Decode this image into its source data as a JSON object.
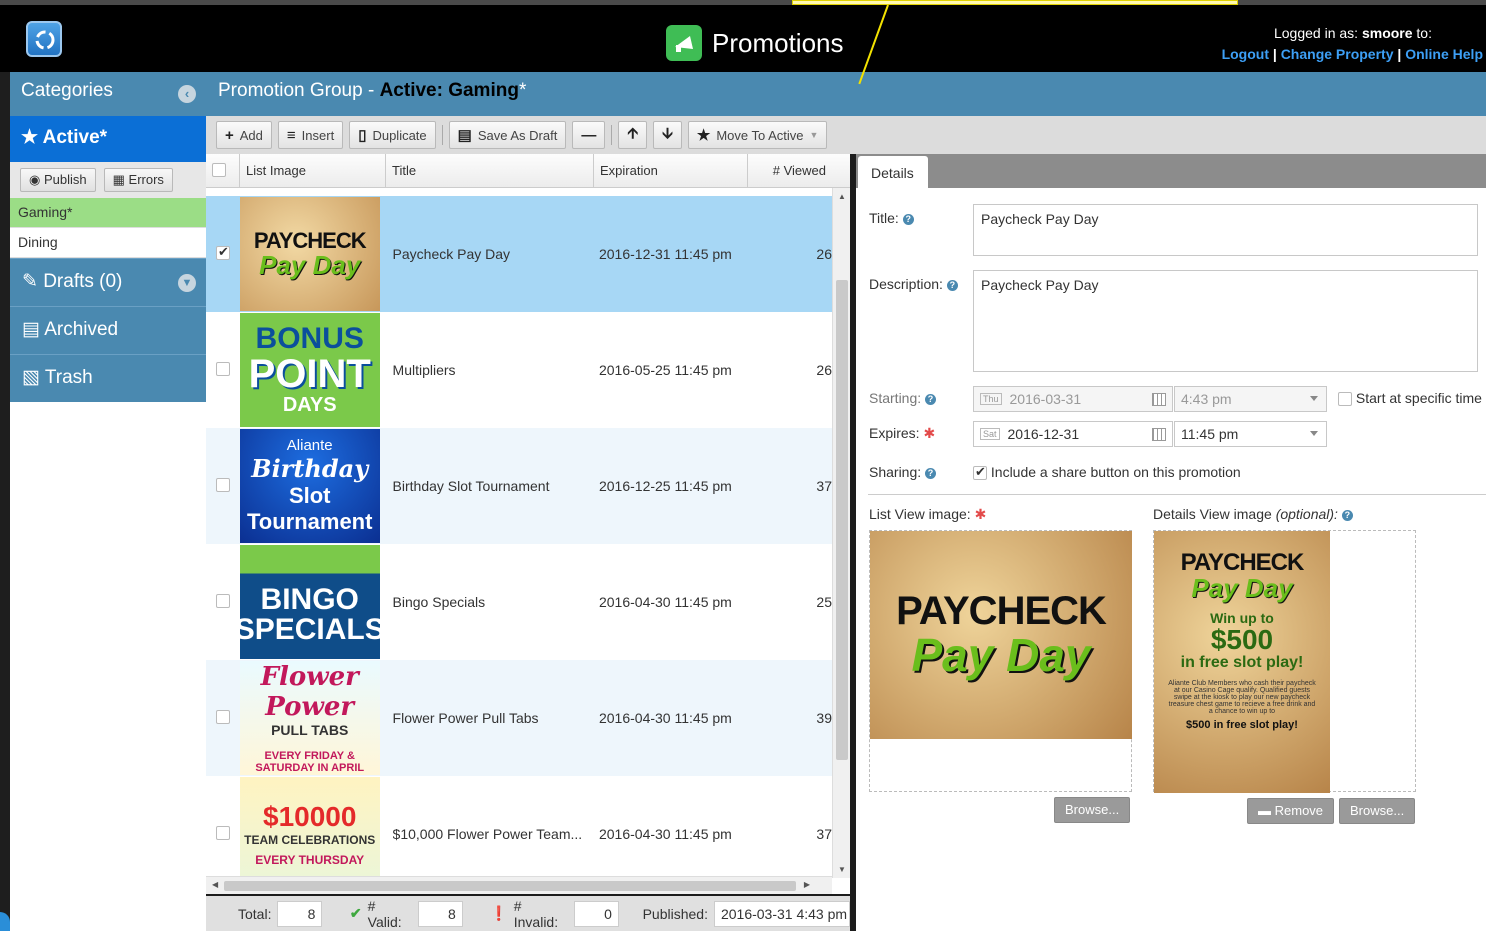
{
  "header": {
    "app_title": "Promotions",
    "logged_in_label": "Logged in as:",
    "username": "smoore",
    "logged_in_suffix": "to:",
    "links": [
      "Logout",
      "Change Property",
      "Online Help"
    ]
  },
  "sidebar": {
    "categories_label": "Categories",
    "active_label": "Active*",
    "publish_label": "Publish",
    "errors_label": "Errors",
    "category_items": [
      "Gaming*",
      "Dining"
    ],
    "drafts_label": "Drafts (0)",
    "archived_label": "Archived",
    "trash_label": "Trash"
  },
  "group_header": {
    "prefix": "Promotion Group - ",
    "name": "Active: Gaming",
    "suffix": "*"
  },
  "toolbar": {
    "add": "Add",
    "insert": "Insert",
    "duplicate": "Duplicate",
    "save_as_draft": "Save As Draft",
    "move_to_active": "Move To Active"
  },
  "list": {
    "columns": [
      "List Image",
      "Title",
      "Expiration",
      "# Viewed"
    ],
    "rows": [
      {
        "title": "Paycheck Pay Day",
        "expiration": "2016-12-31 11:45 pm",
        "viewed": "26",
        "thumb": {
          "t1": "PAYCHECK",
          "t2": "Pay Day"
        }
      },
      {
        "title": "Multipliers",
        "expiration": "2016-05-25 11:45 pm",
        "viewed": "26",
        "thumb": {
          "t1": "BONUS",
          "t2": "POINT",
          "t3": "DAYS"
        }
      },
      {
        "title": "Birthday Slot Tournament",
        "expiration": "2016-12-25 11:45 pm",
        "viewed": "37",
        "thumb": {
          "t1": "Aliante",
          "t2": "Birthday",
          "t3": "Slot Tournament"
        }
      },
      {
        "title": "Bingo Specials",
        "expiration": "2016-04-30 11:45 pm",
        "viewed": "25",
        "thumb": {
          "t1": "BINGO",
          "t2": "SPECIALS"
        }
      },
      {
        "title": "Flower Power Pull Tabs",
        "expiration": "2016-04-30 11:45 pm",
        "viewed": "39",
        "thumb": {
          "t1": "Flower Power",
          "t2": "PULL TABS",
          "t3": "EVERY FRIDAY & SATURDAY IN APRIL"
        }
      },
      {
        "title": "$10,000 Flower Power Team...",
        "expiration": "2016-04-30 11:45 pm",
        "viewed": "37",
        "thumb": {
          "t1": "$10000",
          "t2": "TEAM CELEBRATIONS",
          "t3": "EVERY THURSDAY"
        }
      }
    ]
  },
  "status": {
    "total_label": "Total:",
    "total": "8",
    "valid_label": "# Valid:",
    "valid": "8",
    "invalid_label": "# Invalid:",
    "invalid": "0",
    "published_label": "Published:",
    "published": "2016-03-31 4:43 pm"
  },
  "details": {
    "tab": "Details",
    "title_label": "Title:",
    "title_value": "Paycheck Pay Day",
    "description_label": "Description:",
    "description_value": "Paycheck Pay Day",
    "starting_label": "Starting:",
    "starting_day": "Thu",
    "starting_date": "2016-03-31",
    "starting_time": "4:43 pm",
    "start_specific_label": "Start at specific time",
    "expires_label": "Expires:",
    "expires_day": "Sat",
    "expires_date": "2016-12-31",
    "expires_time": "11:45 pm",
    "sharing_label": "Sharing:",
    "sharing_text": "Include a share button on this promotion",
    "list_view_label": "List View image:",
    "details_view_label": "Details View image",
    "optional_label": "(optional):",
    "browse": "Browse...",
    "remove": "Remove",
    "detail_image": {
      "t1": "PAYCHECK",
      "t2": "Pay Day",
      "t3": "Win up to",
      "t4": "$500",
      "t5": "in free slot play!",
      "t6": "Aliante Club Members who cash their paycheck at our Casino Cage qualify. Qualified guests swipe at the kiosk to play our new paycheck treasure chest game to recieve a free drink and a chance to win up to",
      "t7": "$500 in free slot play!"
    }
  }
}
